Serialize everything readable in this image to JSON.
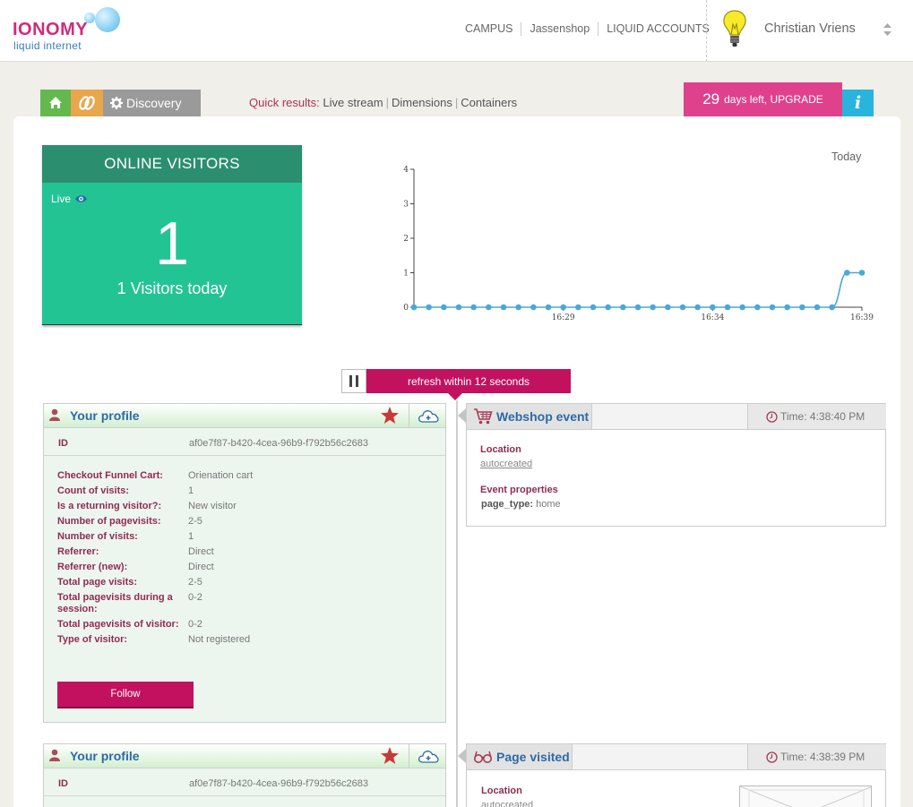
{
  "brand": {
    "name": "IONOMY",
    "tagline": "liquid internet",
    "accent": "#c2125f",
    "green": "#23c494"
  },
  "topnav": {
    "items": [
      "CAMPUS",
      "Jassenshop",
      "LIQUID ACCOUNTS"
    ]
  },
  "user": {
    "name": "Christian Vriens"
  },
  "toolbar": {
    "home_icon": "home-icon",
    "link_icon": "link-icon",
    "discovery_label": "Discovery",
    "quick_label": "Quick results:",
    "quick_links": [
      "Live stream",
      "Dimensions",
      "Containers"
    ],
    "upgrade_days": "29",
    "upgrade_text": "days left, UPGRADE",
    "info_label": "i"
  },
  "visitors_widget": {
    "title": "ONLINE VISITORS",
    "live_label": "Live",
    "count": "1",
    "today_text": "1 Visitors today"
  },
  "chart_data": {
    "type": "line",
    "legend_label": "Today",
    "x_tick_labels": [
      "16:29",
      "16:34",
      "16:39"
    ],
    "y_ticks": [
      0,
      1,
      2,
      3,
      4
    ],
    "ylim": [
      0,
      4
    ],
    "values": [
      0,
      0,
      0,
      0,
      0,
      0,
      0,
      0,
      0,
      0,
      0,
      0,
      0,
      0,
      0,
      0,
      0,
      0,
      0,
      0,
      0,
      0,
      0,
      0,
      0,
      0,
      0,
      0,
      0,
      1,
      1
    ],
    "grid": false,
    "color": "#4aa8d8"
  },
  "refresh": {
    "text": "refresh within 12 seconds"
  },
  "profiles": [
    {
      "title": "Your profile",
      "id_label": "ID",
      "id_value": "af0e7f87-b420-4cea-96b9-f792b56c2683",
      "properties": [
        {
          "label": "Checkout Funnel Cart:",
          "value": "Orienation cart"
        },
        {
          "label": "Count of visits:",
          "value": "1"
        },
        {
          "label": "Is a returning visitor?:",
          "value": "New visitor"
        },
        {
          "label": "Number of pagevisits:",
          "value": "2-5"
        },
        {
          "label": "Number of visits:",
          "value": "1"
        },
        {
          "label": "Referrer:",
          "value": "Direct"
        },
        {
          "label": "Referrer (new):",
          "value": "Direct"
        },
        {
          "label": "Total page visits:",
          "value": "2-5"
        },
        {
          "label": "Total pagevisits during a session:",
          "value": "0-2"
        },
        {
          "label": "Total pagevisits of visitor:",
          "value": "0-2"
        },
        {
          "label": "Type of visitor:",
          "value": "Not registered"
        }
      ],
      "follow_label": "Follow"
    },
    {
      "title": "Your profile",
      "id_label": "ID",
      "id_value": "af0e7f87-b420-4cea-96b9-f792b56c2683"
    }
  ],
  "events": [
    {
      "title": "Webshop event",
      "icon": "cart-icon",
      "time": "Time: 4:38:40 PM",
      "location_label": "Location",
      "location_value": "autocreated",
      "props_label": "Event properties",
      "prop_key": "page_type:",
      "prop_value": "home"
    },
    {
      "title": "Page visited",
      "icon": "glasses-icon",
      "time": "Time: 4:38:39 PM",
      "location_label": "Location",
      "location_value": "autocreated"
    }
  ]
}
